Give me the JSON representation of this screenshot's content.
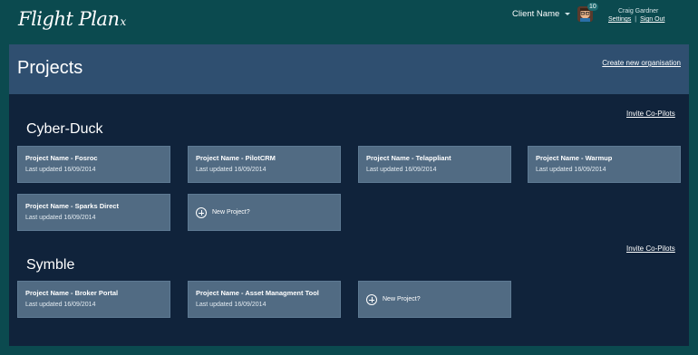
{
  "app": {
    "logo": "Flight Plan",
    "logo_suffix": "x"
  },
  "topbar": {
    "client_select": "Client Name",
    "notification_count": "10",
    "user_name": "Craig Gardner",
    "settings_link": "Settings",
    "separator": "|",
    "signout_link": "Sign Out"
  },
  "header": {
    "title": "Projects",
    "create_org_link": "Create new organisation"
  },
  "organisations": [
    {
      "name": "Cyber-Duck",
      "invite_link": "Invite Co-Pilots",
      "projects": [
        {
          "name": "Project Name - Fosroc",
          "updated": "Last updated 16/09/2014"
        },
        {
          "name": "Project Name - PilotCRM",
          "updated": "Last updated 16/09/2014"
        },
        {
          "name": "Project Name - Telappliant",
          "updated": "Last updated 16/09/2014"
        },
        {
          "name": "Project Name - Warmup",
          "updated": "Last updated 16/09/2014"
        },
        {
          "name": "Project Name - Sparks Direct",
          "updated": "Last updated 16/09/2014"
        }
      ],
      "new_project_label": "New Project?"
    },
    {
      "name": "Symble",
      "invite_link": "Invite Co-Pilots",
      "projects": [
        {
          "name": "Project Name - Broker Portal",
          "updated": "Last updated 16/09/2014"
        },
        {
          "name": "Project Name - Asset Managment Tool",
          "updated": "Last updated 16/09/2014"
        }
      ],
      "new_project_label": "New Project?"
    }
  ],
  "colors": {
    "page_bg": "#0b4a4f",
    "banner_bg": "#2f4f70",
    "content_bg": "#10233b",
    "card_bg": "#516b83"
  }
}
